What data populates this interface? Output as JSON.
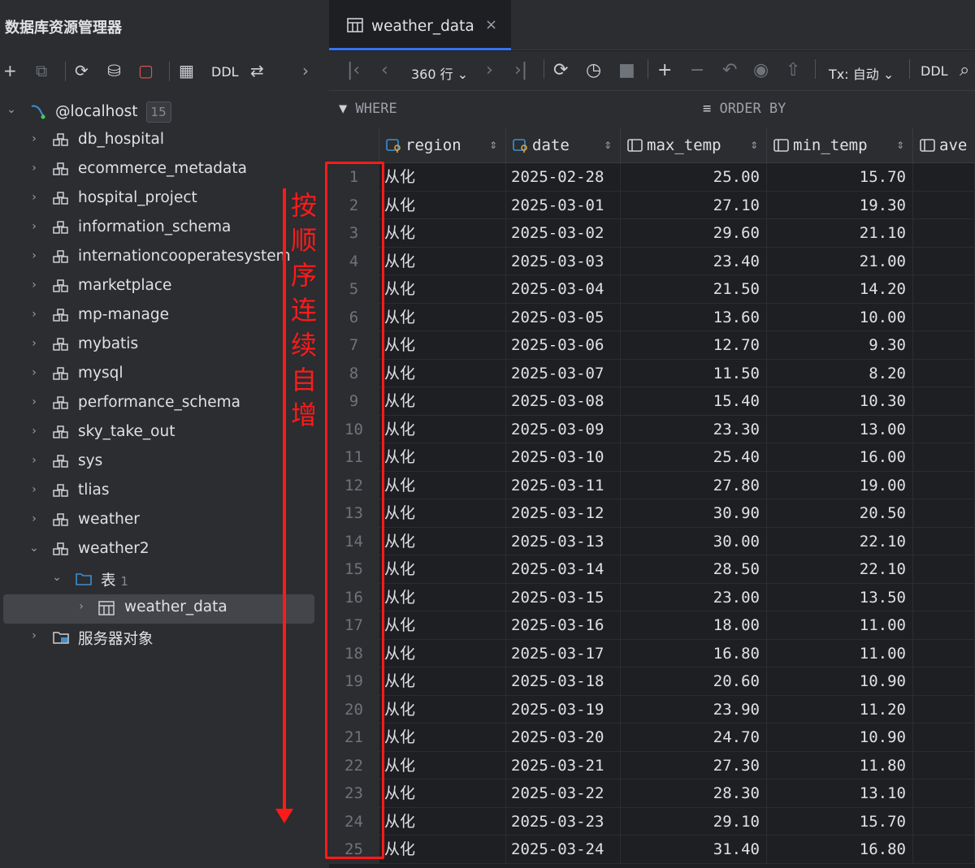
{
  "left_panel": {
    "title": "数据库资源管理器",
    "toolbar": {
      "ddl_label": "DDL"
    },
    "tree": {
      "root": {
        "label": "@localhost",
        "count": "15"
      },
      "databases": [
        "db_hospital",
        "ecommerce_metadata",
        "hospital_project",
        "information_schema",
        "internationcooperatesystem",
        "marketplace",
        "mp-manage",
        "mybatis",
        "mysql",
        "performance_schema",
        "sky_take_out",
        "sys",
        "tlias",
        "weather",
        "weather2"
      ],
      "tables_folder": {
        "label": "表",
        "count": "1"
      },
      "selected_table": "weather_data",
      "server_objects": "服务器对象"
    }
  },
  "editor": {
    "tab": {
      "label": "weather_data",
      "close": "×"
    },
    "toolbar": {
      "row_count": "360 行",
      "tx_label": "Tx: 自动",
      "ddl_label": "DDL"
    },
    "filter": {
      "where": "WHERE",
      "order_by": "ORDER BY"
    },
    "columns": [
      {
        "name": "region",
        "key": true
      },
      {
        "name": "date",
        "key": true
      },
      {
        "name": "max_temp",
        "key": false
      },
      {
        "name": "min_temp",
        "key": false
      },
      {
        "name": "ave",
        "key": false
      }
    ],
    "rows": [
      [
        "1",
        "从化",
        "2025-02-28",
        "25.00",
        "15.70"
      ],
      [
        "2",
        "从化",
        "2025-03-01",
        "27.10",
        "19.30"
      ],
      [
        "3",
        "从化",
        "2025-03-02",
        "29.60",
        "21.10"
      ],
      [
        "4",
        "从化",
        "2025-03-03",
        "23.40",
        "21.00"
      ],
      [
        "5",
        "从化",
        "2025-03-04",
        "21.50",
        "14.20"
      ],
      [
        "6",
        "从化",
        "2025-03-05",
        "13.60",
        "10.00"
      ],
      [
        "7",
        "从化",
        "2025-03-06",
        "12.70",
        "9.30"
      ],
      [
        "8",
        "从化",
        "2025-03-07",
        "11.50",
        "8.20"
      ],
      [
        "9",
        "从化",
        "2025-03-08",
        "15.40",
        "10.30"
      ],
      [
        "10",
        "从化",
        "2025-03-09",
        "23.30",
        "13.00"
      ],
      [
        "11",
        "从化",
        "2025-03-10",
        "25.40",
        "16.00"
      ],
      [
        "12",
        "从化",
        "2025-03-11",
        "27.80",
        "19.00"
      ],
      [
        "13",
        "从化",
        "2025-03-12",
        "30.90",
        "20.50"
      ],
      [
        "14",
        "从化",
        "2025-03-13",
        "30.00",
        "22.10"
      ],
      [
        "15",
        "从化",
        "2025-03-14",
        "28.50",
        "22.10"
      ],
      [
        "16",
        "从化",
        "2025-03-15",
        "23.00",
        "13.50"
      ],
      [
        "17",
        "从化",
        "2025-03-16",
        "18.00",
        "11.00"
      ],
      [
        "18",
        "从化",
        "2025-03-17",
        "16.80",
        "11.00"
      ],
      [
        "19",
        "从化",
        "2025-03-18",
        "20.60",
        "10.90"
      ],
      [
        "20",
        "从化",
        "2025-03-19",
        "23.90",
        "11.20"
      ],
      [
        "21",
        "从化",
        "2025-03-20",
        "24.70",
        "10.90"
      ],
      [
        "22",
        "从化",
        "2025-03-21",
        "27.30",
        "11.80"
      ],
      [
        "23",
        "从化",
        "2025-03-22",
        "28.30",
        "13.10"
      ],
      [
        "24",
        "从化",
        "2025-03-23",
        "29.10",
        "15.70"
      ],
      [
        "25",
        "从化",
        "2025-03-24",
        "31.40",
        "16.80"
      ]
    ]
  },
  "annotation": {
    "text": "按顺序连续自增",
    "color": "#ff1a1a"
  }
}
